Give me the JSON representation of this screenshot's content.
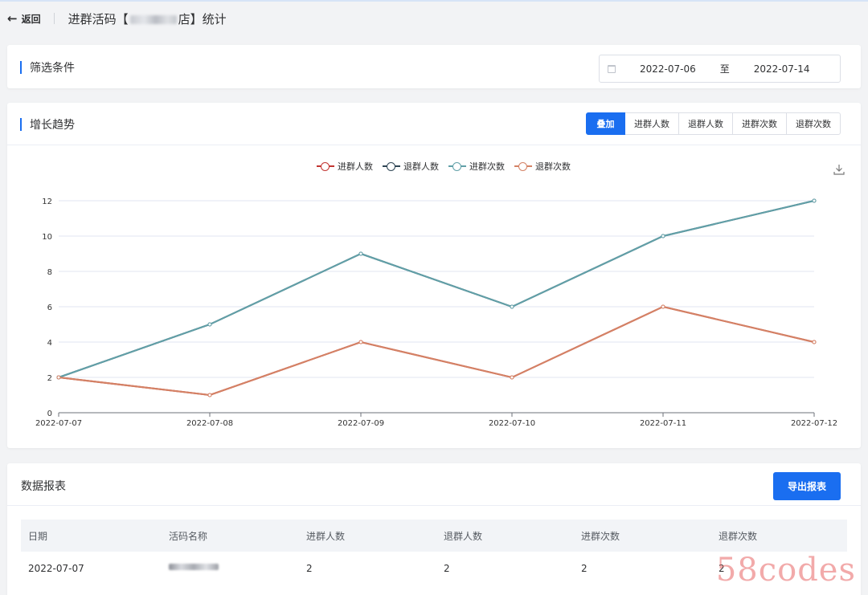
{
  "header": {
    "back_label": "返回",
    "title_prefix": "进群活码【",
    "title_suffix": "店】统计"
  },
  "filter": {
    "title": "筛选条件",
    "date_start": "2022-07-06",
    "date_sep": "至",
    "date_end": "2022-07-14"
  },
  "trend": {
    "title": "增长趋势",
    "tabs": [
      "叠加",
      "进群人数",
      "退群人数",
      "进群次数",
      "退群次数"
    ],
    "active_tab": 0
  },
  "chart_data": {
    "type": "line",
    "categories": [
      "2022-07-07",
      "2022-07-08",
      "2022-07-09",
      "2022-07-10",
      "2022-07-11",
      "2022-07-12"
    ],
    "ylim": [
      0,
      12
    ],
    "yticks": [
      0,
      2,
      4,
      6,
      8,
      10,
      12
    ],
    "legend_position": "top",
    "grid": true,
    "series": [
      {
        "name": "进群人数",
        "color": "#c23531",
        "values": [
          2,
          1,
          4,
          2,
          6,
          4
        ]
      },
      {
        "name": "退群人数",
        "color": "#2f4554",
        "values": [
          2,
          5,
          9,
          6,
          10,
          12
        ]
      },
      {
        "name": "进群次数",
        "color": "#61a0a8",
        "values": [
          2,
          5,
          9,
          6,
          10,
          12
        ]
      },
      {
        "name": "退群次数",
        "color": "#d48265",
        "values": [
          2,
          1,
          4,
          2,
          6,
          4
        ]
      }
    ]
  },
  "report": {
    "title": "数据报表",
    "export_label": "导出报表",
    "columns": [
      "日期",
      "活码名称",
      "进群人数",
      "退群人数",
      "进群次数",
      "退群次数"
    ],
    "rows": [
      {
        "date": "2022-07-07",
        "in_people": "2",
        "out_people": "2",
        "in_times": "2",
        "out_times": "2"
      }
    ]
  },
  "watermark": "58codes"
}
